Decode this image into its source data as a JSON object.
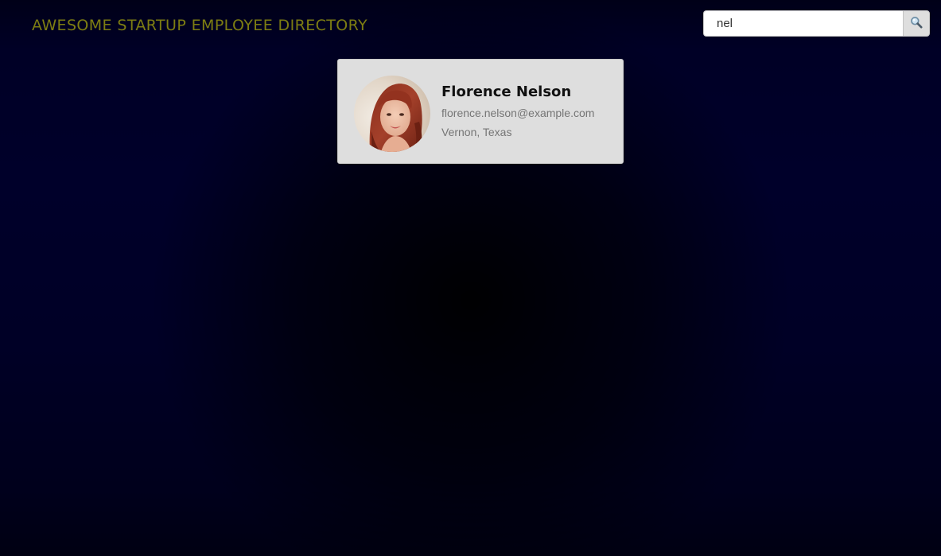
{
  "header": {
    "title": "AWESOME STARTUP EMPLOYEE DIRECTORY",
    "title_color": "#7d7d12"
  },
  "search": {
    "value": "nel",
    "button_icon": "search-icon"
  },
  "results": [
    {
      "name": "Florence Nelson",
      "email": "florence.nelson@example.com",
      "location": "Vernon, Texas",
      "avatar_icon": "employee-photo"
    }
  ],
  "colors": {
    "background": "#00001e",
    "card_background": "#dedede",
    "name": "#111111",
    "detail_text": "#757575"
  }
}
